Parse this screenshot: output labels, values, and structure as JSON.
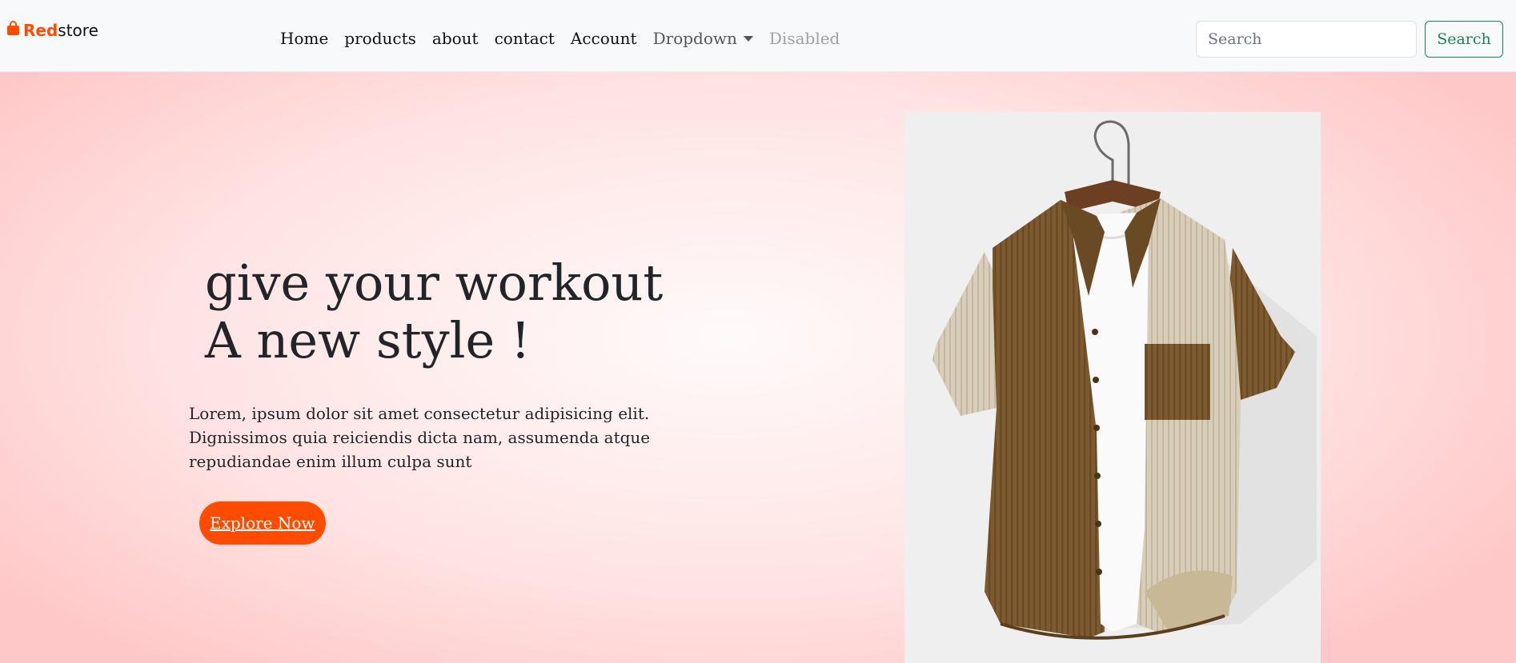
{
  "brand": {
    "name_accent": "Red",
    "name_rest": "store",
    "icon": "shopping-bag-icon",
    "accent_color": "#ff4c00"
  },
  "nav": {
    "items": [
      {
        "label": "Home"
      },
      {
        "label": "products"
      },
      {
        "label": "about"
      },
      {
        "label": "contact"
      },
      {
        "label": "Account"
      }
    ],
    "dropdown_label": "Dropdown",
    "disabled_label": "Disabled"
  },
  "search": {
    "placeholder": "Search",
    "button_label": "Search",
    "button_color": "#198754"
  },
  "hero": {
    "headline_line1": "give your workout",
    "headline_line2": "A new style !",
    "description": "Lorem, ipsum dolor sit amet consectetur adipisicing elit. Dignissimos quia reiciendis dicta nam, assumenda atque repudiandae enim illum culpa sunt",
    "cta_label": "Explore Now",
    "cta_color": "#ff4c00",
    "image_subject": "shirt-on-hanger"
  }
}
